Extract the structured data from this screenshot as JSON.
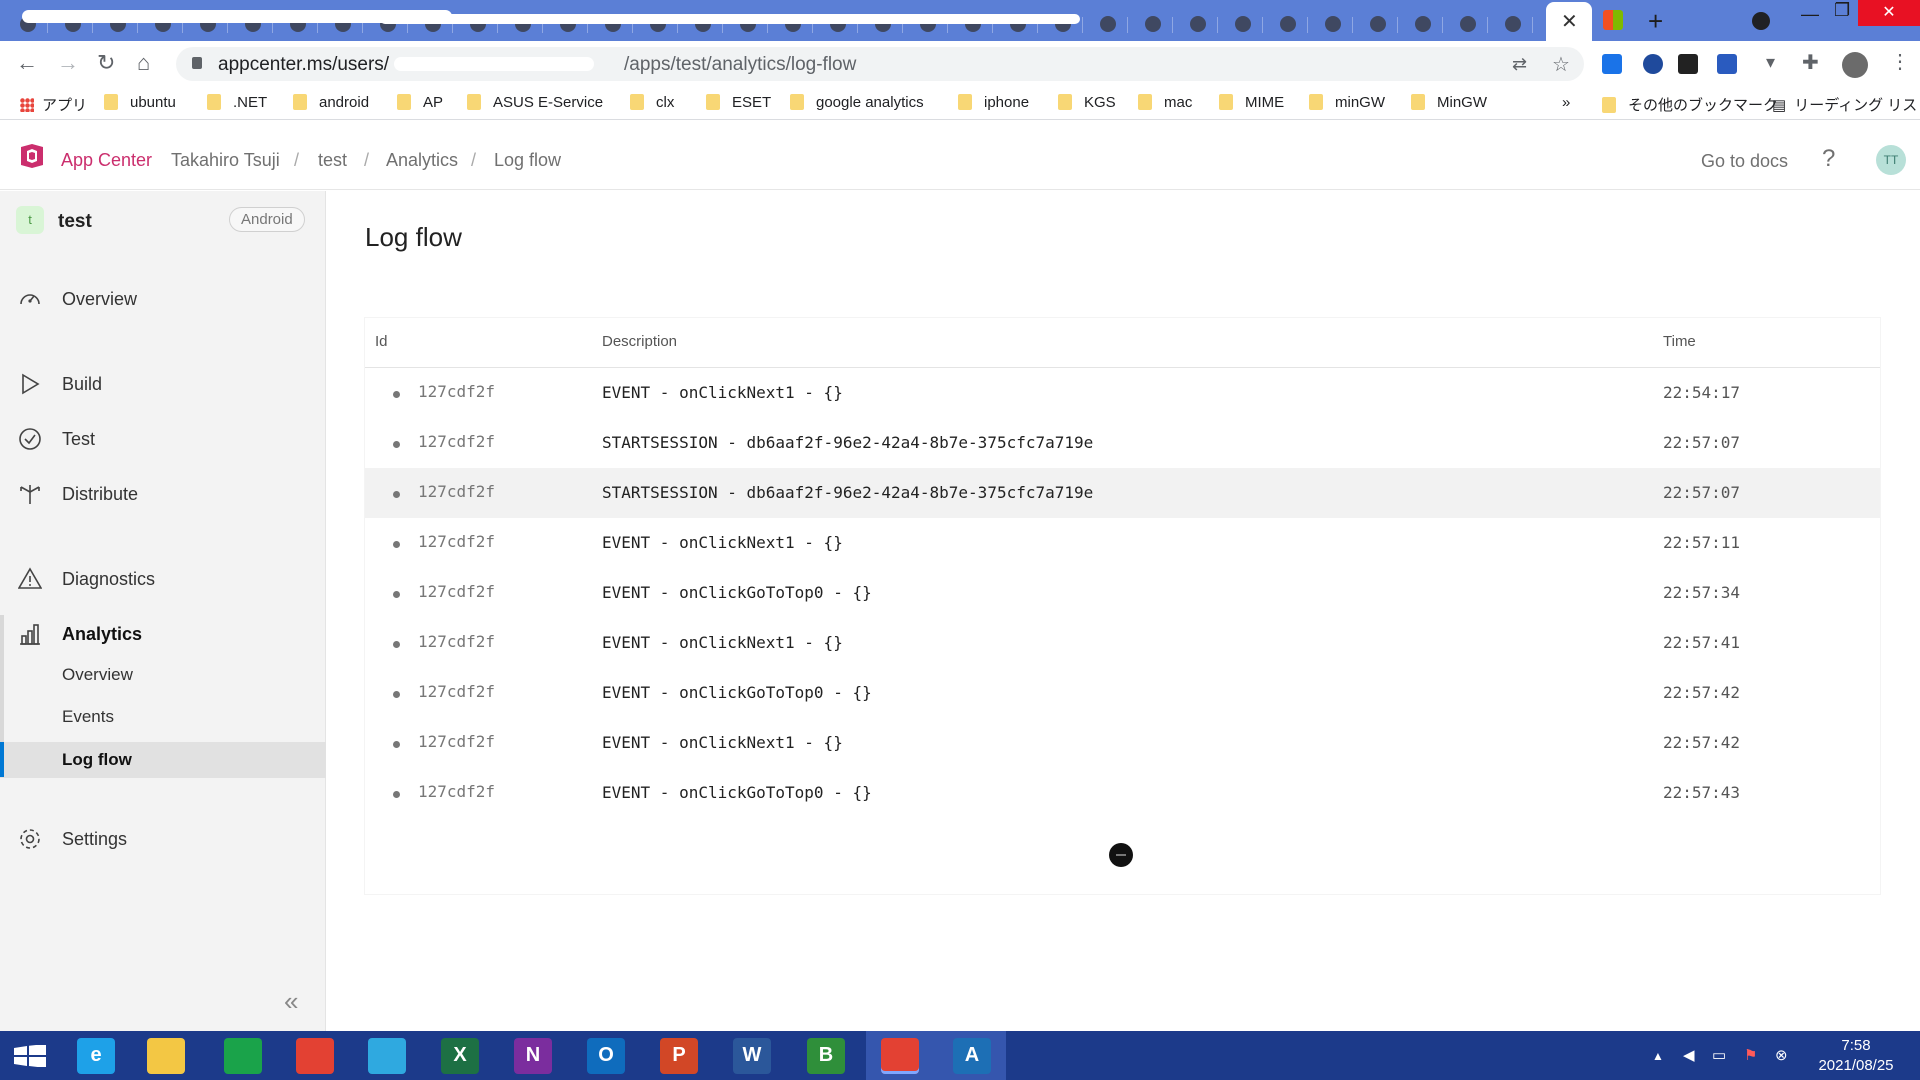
{
  "browser": {
    "active_tab_close": "✕",
    "new_tab": "+",
    "url_host": "appcenter.ms/users/",
    "url_path": "/apps/test/analytics/log-flow",
    "bookmarks": [
      {
        "label": "アプリ",
        "kind": "apps"
      },
      {
        "label": "ubuntu",
        "kind": "folder"
      },
      {
        "label": ".NET",
        "kind": "folder"
      },
      {
        "label": "android",
        "kind": "folder"
      },
      {
        "label": "AP",
        "kind": "folder"
      },
      {
        "label": "ASUS E-Service",
        "kind": "folder"
      },
      {
        "label": "clx",
        "kind": "folder"
      },
      {
        "label": "ESET",
        "kind": "folder"
      },
      {
        "label": "google analytics",
        "kind": "folder"
      },
      {
        "label": "iphone",
        "kind": "folder"
      },
      {
        "label": "KGS",
        "kind": "folder"
      },
      {
        "label": "mac",
        "kind": "folder"
      },
      {
        "label": "MIME",
        "kind": "folder"
      },
      {
        "label": "minGW",
        "kind": "folder"
      },
      {
        "label": "MinGW",
        "kind": "folder"
      }
    ],
    "bookmarks_overflow": "»",
    "other_bookmarks": "その他のブックマーク",
    "reading_list": "リーディング リスト"
  },
  "header": {
    "brand": "App Center",
    "breadcrumb": [
      "Takahiro Tsuji",
      "test",
      "Analytics",
      "Log flow"
    ],
    "breadcrumb_sep": "/",
    "docs_link": "Go to docs",
    "help": "?",
    "avatar_initials": "TT",
    "brand_color": "#cb2e6d"
  },
  "sidebar": {
    "app_badge": "t",
    "app_name": "test",
    "platform": "Android",
    "items": [
      {
        "label": "Overview",
        "icon": "gauge-icon"
      },
      {
        "label": "Build",
        "icon": "play-icon"
      },
      {
        "label": "Test",
        "icon": "check-circle-icon"
      },
      {
        "label": "Distribute",
        "icon": "distribute-icon"
      },
      {
        "label": "Diagnostics",
        "icon": "warning-icon"
      },
      {
        "label": "Analytics",
        "icon": "bar-chart-icon"
      },
      {
        "label": "Settings",
        "icon": "gear-icon"
      }
    ],
    "analytics_sub": [
      "Overview",
      "Events",
      "Log flow"
    ],
    "active_sub": "Log flow",
    "collapse": "«"
  },
  "main": {
    "title": "Log flow",
    "columns": {
      "id": "Id",
      "description": "Description",
      "time": "Time"
    },
    "rows": [
      {
        "id": "127cdf2f",
        "description": "EVENT - onClickNext1 - {}",
        "time": "22:54:17"
      },
      {
        "id": "127cdf2f",
        "description": "STARTSESSION - db6aaf2f-96e2-42a4-8b7e-375cfc7a719e",
        "time": "22:57:07"
      },
      {
        "id": "127cdf2f",
        "description": "STARTSESSION - db6aaf2f-96e2-42a4-8b7e-375cfc7a719e",
        "time": "22:57:07"
      },
      {
        "id": "127cdf2f",
        "description": "EVENT - onClickNext1 - {}",
        "time": "22:57:11"
      },
      {
        "id": "127cdf2f",
        "description": "EVENT - onClickGoToTop0 - {}",
        "time": "22:57:34"
      },
      {
        "id": "127cdf2f",
        "description": "EVENT - onClickNext1 - {}",
        "time": "22:57:41"
      },
      {
        "id": "127cdf2f",
        "description": "EVENT - onClickGoToTop0 - {}",
        "time": "22:57:42"
      },
      {
        "id": "127cdf2f",
        "description": "EVENT - onClickNext1 - {}",
        "time": "22:57:42"
      },
      {
        "id": "127cdf2f",
        "description": "EVENT - onClickGoToTop0 - {}",
        "time": "22:57:43"
      }
    ]
  },
  "taskbar": {
    "apps": [
      {
        "name": "ie-icon",
        "letter": "e",
        "color": "#1ea1e8"
      },
      {
        "name": "file-explorer-icon",
        "letter": "",
        "color": "#f3c744"
      },
      {
        "name": "store-icon",
        "letter": "",
        "color": "#1aa34a"
      },
      {
        "name": "chrome-icon",
        "letter": "",
        "color": "#e34133"
      },
      {
        "name": "edge-icon",
        "letter": "",
        "color": "#2fa9e0"
      },
      {
        "name": "excel-icon",
        "letter": "X",
        "color": "#1d7044"
      },
      {
        "name": "onenote-icon",
        "letter": "N",
        "color": "#7b2d9e"
      },
      {
        "name": "outlook-icon",
        "letter": "O",
        "color": "#0f6cbd"
      },
      {
        "name": "powerpoint-icon",
        "letter": "P",
        "color": "#d24726"
      },
      {
        "name": "word-icon",
        "letter": "W",
        "color": "#2b579a"
      },
      {
        "name": "app-b-icon",
        "letter": "B",
        "color": "#2f8f3a"
      },
      {
        "name": "chrome-open-icon",
        "letter": "",
        "color": "#e34133"
      },
      {
        "name": "android-studio-icon",
        "letter": "A",
        "color": "#1d6fb5"
      }
    ],
    "time": "7:58",
    "date": "2021/08/25"
  }
}
